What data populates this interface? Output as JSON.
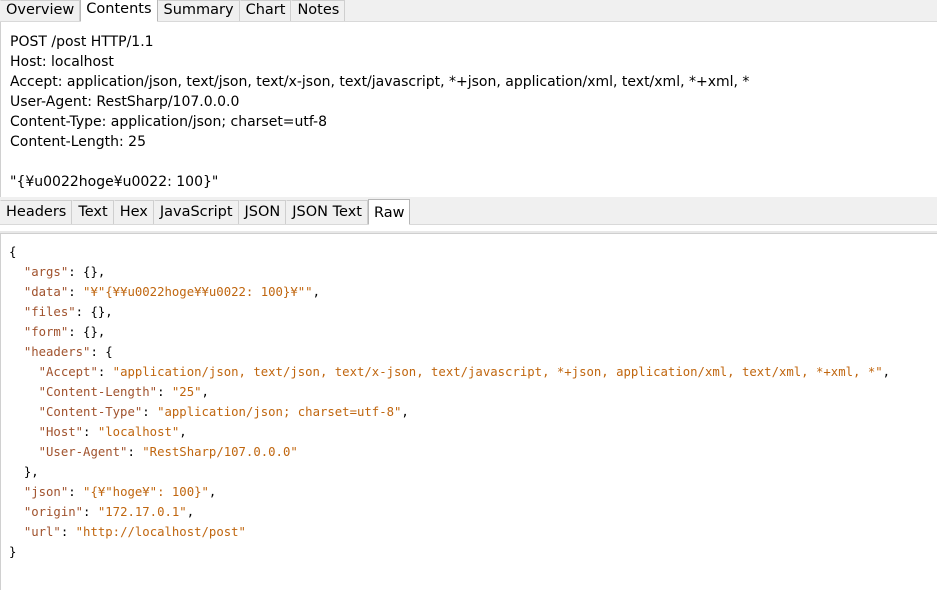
{
  "top_tabs": [
    "Overview",
    "Contents",
    "Summary",
    "Chart",
    "Notes"
  ],
  "top_tabs_selected": "Contents",
  "request": {
    "lines": [
      "POST /post HTTP/1.1",
      "Host: localhost",
      "Accept: application/json, text/json, text/x-json, text/javascript, *+json, application/xml, text/xml, *+xml, *",
      "User-Agent: RestSharp/107.0.0.0",
      "Content-Type: application/json; charset=utf-8",
      "Content-Length: 25",
      "",
      "\"{¥u0022hoge¥u0022: 100}\""
    ]
  },
  "response_tabs": [
    "Headers",
    "Text",
    "Hex",
    "JavaScript",
    "JSON",
    "JSON Text",
    "Raw"
  ],
  "response_tabs_selected": "Raw",
  "response": {
    "lines": [
      {
        "indent": "",
        "key": "",
        "sep": "",
        "value": "",
        "tail": "{"
      },
      {
        "indent": "  ",
        "key": "\"args\"",
        "sep": ": ",
        "value": "",
        "tail": "{},"
      },
      {
        "indent": "  ",
        "key": "\"data\"",
        "sep": ": ",
        "value": "\"¥\"{¥¥u0022hoge¥¥u0022: 100}¥\"\"",
        "tail": ","
      },
      {
        "indent": "  ",
        "key": "\"files\"",
        "sep": ": ",
        "value": "",
        "tail": "{},"
      },
      {
        "indent": "  ",
        "key": "\"form\"",
        "sep": ": ",
        "value": "",
        "tail": "{},"
      },
      {
        "indent": "  ",
        "key": "\"headers\"",
        "sep": ": ",
        "value": "",
        "tail": "{"
      },
      {
        "indent": "    ",
        "key": "\"Accept\"",
        "sep": ": ",
        "value": "\"application/json, text/json, text/x-json, text/javascript, *+json, application/xml, text/xml, *+xml, *\"",
        "tail": ","
      },
      {
        "indent": "    ",
        "key": "\"Content-Length\"",
        "sep": ": ",
        "value": "\"25\"",
        "tail": ","
      },
      {
        "indent": "    ",
        "key": "\"Content-Type\"",
        "sep": ": ",
        "value": "\"application/json; charset=utf-8\"",
        "tail": ","
      },
      {
        "indent": "    ",
        "key": "\"Host\"",
        "sep": ": ",
        "value": "\"localhost\"",
        "tail": ","
      },
      {
        "indent": "    ",
        "key": "\"User-Agent\"",
        "sep": ": ",
        "value": "\"RestSharp/107.0.0.0\"",
        "tail": ""
      },
      {
        "indent": "  ",
        "key": "",
        "sep": "",
        "value": "",
        "tail": "},"
      },
      {
        "indent": "  ",
        "key": "\"json\"",
        "sep": ": ",
        "value": "\"{¥\"hoge¥\": 100}\"",
        "tail": ","
      },
      {
        "indent": "  ",
        "key": "\"origin\"",
        "sep": ": ",
        "value": "\"172.17.0.1\"",
        "tail": ","
      },
      {
        "indent": "  ",
        "key": "\"url\"",
        "sep": ": ",
        "value": "\"http://localhost/post\"",
        "tail": ""
      },
      {
        "indent": "",
        "key": "",
        "sep": "",
        "value": "",
        "tail": "}"
      }
    ]
  },
  "colors": {
    "json_key": "#a0522d",
    "json_string": "#c0660f",
    "tab_bar": "#f0f0f0"
  }
}
